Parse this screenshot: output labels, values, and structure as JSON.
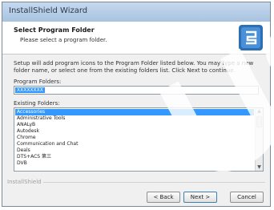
{
  "window": {
    "title": "InstallShield Wizard"
  },
  "banner": {
    "title": "Select Program Folder",
    "subtitle": "Please select a program folder.",
    "icon": "installshield-icon"
  },
  "instructions": "Setup will add program icons to the Program Folder listed below. You may type a new folder name, or select one from the existing folders list. Click Next to continue.",
  "program_folder": {
    "label": "Program Folders:",
    "value": "XXXXXXXX"
  },
  "existing_folders": {
    "label": "Existing Folders:",
    "items": [
      "Accessories",
      "Administrative Tools",
      "ANALyB",
      "Autodesk",
      "Chrome",
      "Communication and Chat",
      "Deals",
      "DTS+ACS 第三",
      "DVB"
    ],
    "selected_index": 0
  },
  "footer": {
    "brand": "InstallShield"
  },
  "buttons": {
    "back": "< Back",
    "next": "Next >",
    "cancel": "Cancel"
  },
  "watermark": {
    "text": "US"
  }
}
